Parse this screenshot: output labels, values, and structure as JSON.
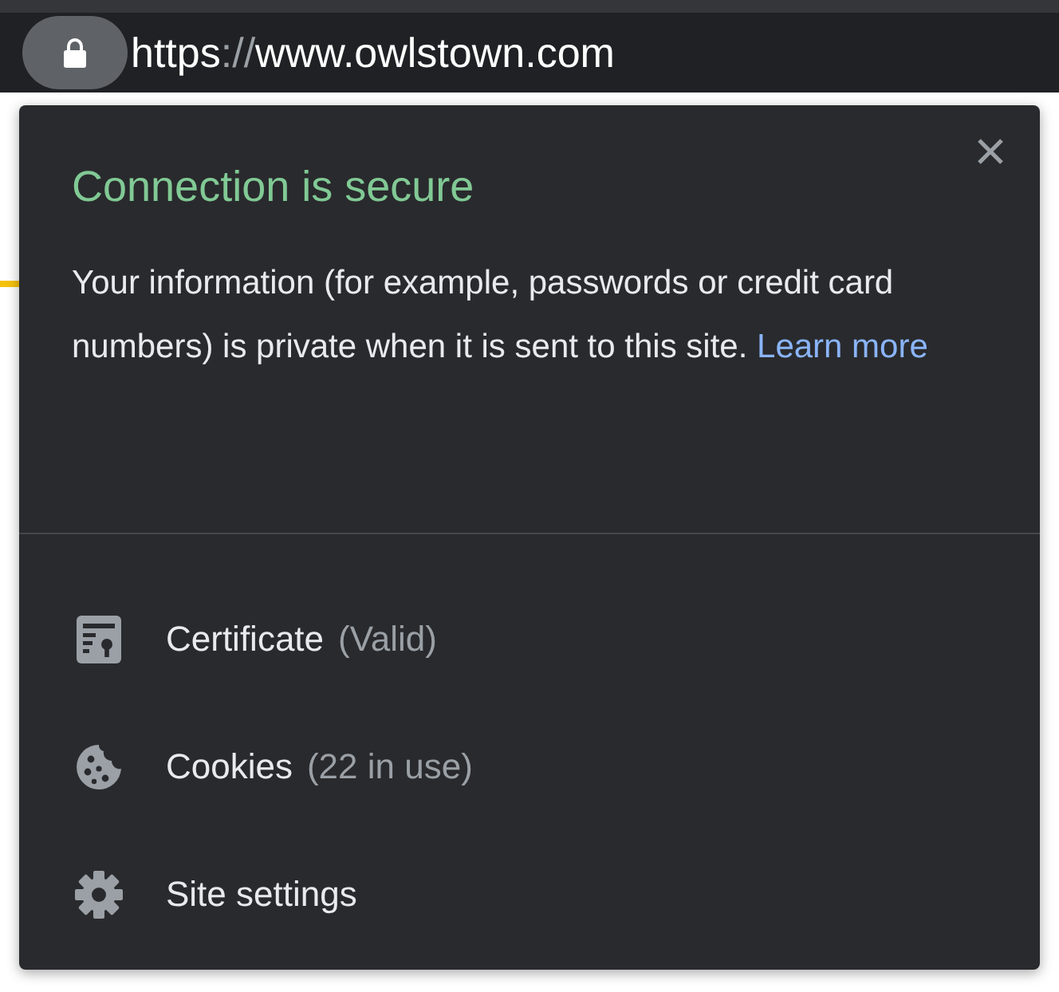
{
  "address_bar": {
    "scheme": "https",
    "separator": "://",
    "host": "www.owlstown.com"
  },
  "popup": {
    "title": "Connection is secure",
    "body": "Your information (for example, passwords or credit card numbers) is private when it is sent to this site.",
    "link": "Learn more",
    "items": [
      {
        "kind": "certificate",
        "label": "Certificate",
        "detail": "(Valid)"
      },
      {
        "kind": "cookies",
        "label": "Cookies",
        "detail": "(22 in use)"
      },
      {
        "kind": "settings",
        "label": "Site settings"
      }
    ]
  }
}
